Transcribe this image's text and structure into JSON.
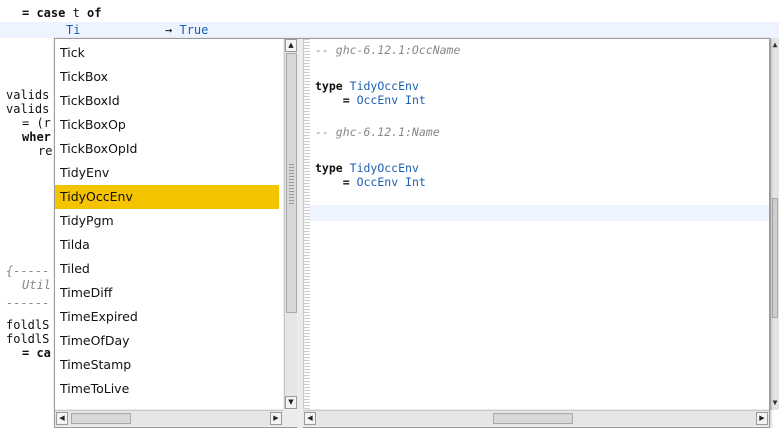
{
  "editor": {
    "line1": {
      "kw1": "= case",
      "mid": " t ",
      "kw2": "of"
    },
    "line2": {
      "typed": "Ti",
      "arrow": "→",
      "value": "True"
    },
    "left_fragments": [
      "valids",
      "valids",
      "= (r",
      "wher",
      "re",
      "{-----",
      "Util",
      "------",
      "foldlS",
      "foldlS",
      "= ca"
    ]
  },
  "completion": {
    "items": [
      "Tick",
      "TickBox",
      "TickBoxId",
      "TickBoxOp",
      "TickBoxOpId",
      "TidyEnv",
      "TidyOccEnv",
      "TidyPgm",
      "Tilda",
      "Tiled",
      "TimeDiff",
      "TimeExpired",
      "TimeOfDay",
      "TimeStamp",
      "TimeToLive"
    ],
    "selected_index": 6
  },
  "doc": {
    "comment1": "-- ghc-6.12.1:OccName",
    "kw_type": "type",
    "type1_name": "TidyOccEnv",
    "eq": "=",
    "def1": "OccEnv Int",
    "comment2": "-- ghc-6.12.1:Name",
    "type2_name": "TidyOccEnv",
    "def2": "OccEnv Int"
  },
  "icons": {
    "scroll_up": "arrow-up-icon",
    "scroll_down": "arrow-down-icon",
    "scroll_left": "arrow-left-icon",
    "scroll_right": "arrow-right-icon"
  },
  "colors": {
    "selection": "#f5c400",
    "type_name": "#1a5fb4",
    "comment": "#888888"
  }
}
